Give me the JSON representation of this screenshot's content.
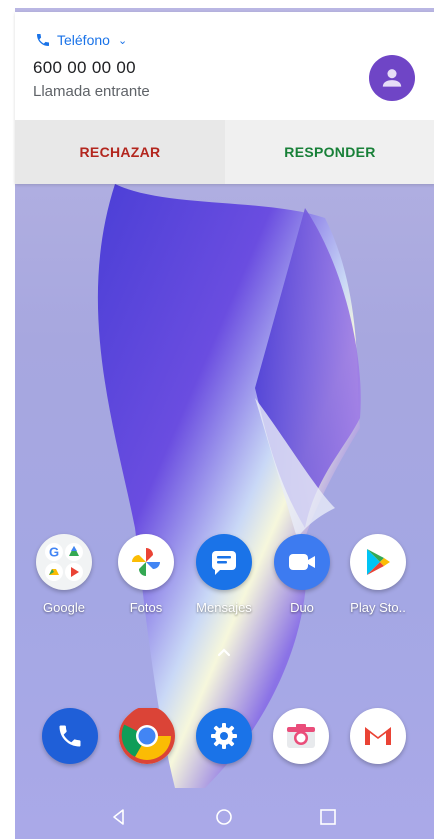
{
  "notification": {
    "app_name": "Teléfono",
    "caller": "600 00 00 00",
    "status": "Llamada entrante",
    "reject_label": "RECHAZAR",
    "answer_label": "RESPONDER"
  },
  "apps": [
    {
      "label": "Google",
      "icon": "google-folder-icon"
    },
    {
      "label": "Fotos",
      "icon": "photos-icon"
    },
    {
      "label": "Mensajes",
      "icon": "messages-icon"
    },
    {
      "label": "Duo",
      "icon": "duo-icon"
    },
    {
      "label": "Play Sto..",
      "icon": "play-store-icon"
    }
  ],
  "dock": [
    {
      "icon": "phone-icon"
    },
    {
      "icon": "chrome-icon"
    },
    {
      "icon": "settings-icon"
    },
    {
      "icon": "camera-icon"
    },
    {
      "icon": "gmail-icon"
    }
  ],
  "colors": {
    "accent": "#1a73e8",
    "reject": "#b3261e",
    "answer": "#188038",
    "avatar": "#6f45c6"
  }
}
